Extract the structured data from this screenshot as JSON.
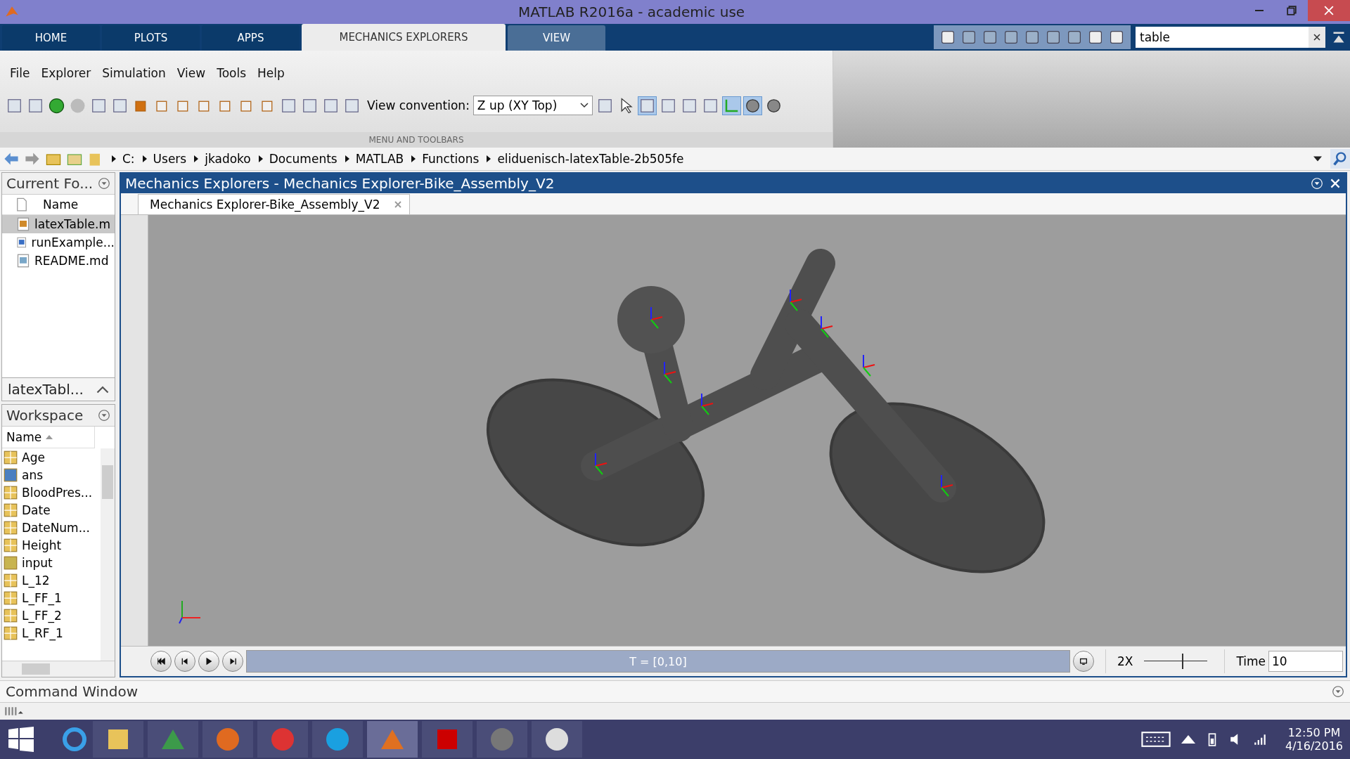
{
  "window": {
    "title": "MATLAB R2016a - academic use"
  },
  "ribbon_tabs": [
    {
      "label": "HOME",
      "selected": false
    },
    {
      "label": "PLOTS",
      "selected": false
    },
    {
      "label": "APPS",
      "selected": false
    },
    {
      "label": "MECHANICS EXPLORERS",
      "selected": true
    },
    {
      "label": "VIEW",
      "selected": false
    }
  ],
  "search": {
    "value": "table"
  },
  "menu": [
    "File",
    "Explorer",
    "Simulation",
    "View",
    "Tools",
    "Help"
  ],
  "view_convention": {
    "label": "View convention:",
    "value": "Z up (XY Top)"
  },
  "toolstrip_section": "MENU AND TOOLBARS",
  "path": [
    "C:",
    "Users",
    "jkadoko",
    "Documents",
    "MATLAB",
    "Functions",
    "eliduenisch-latexTable-2b505fe"
  ],
  "current_folder": {
    "title": "Current Fo...",
    "column": "Name",
    "details": "latexTabl...",
    "files": [
      {
        "name": "latexTable.m",
        "selected": true,
        "kind": "function"
      },
      {
        "name": "runExample...",
        "selected": false,
        "kind": "script"
      },
      {
        "name": "README.md",
        "selected": false,
        "kind": "doc"
      }
    ]
  },
  "workspace": {
    "title": "Workspace",
    "column": "Name",
    "variables": [
      {
        "name": "Age",
        "kind": "table"
      },
      {
        "name": "ans",
        "kind": "object"
      },
      {
        "name": "BloodPres...",
        "kind": "table"
      },
      {
        "name": "Date",
        "kind": "table"
      },
      {
        "name": "DateNum...",
        "kind": "table"
      },
      {
        "name": "Height",
        "kind": "table"
      },
      {
        "name": "input",
        "kind": "enum"
      },
      {
        "name": "L_12",
        "kind": "table"
      },
      {
        "name": "L_FF_1",
        "kind": "table"
      },
      {
        "name": "L_FF_2",
        "kind": "table"
      },
      {
        "name": "L_RF_1",
        "kind": "table"
      }
    ]
  },
  "explorer": {
    "title": "Mechanics Explorers - Mechanics Explorer-Bike_Assembly_V2",
    "tab": "Mechanics Explorer-Bike_Assembly_V2",
    "playback": {
      "label": "T = [0,10]",
      "level": 1
    },
    "speed": {
      "label": "2X",
      "level": 0.6
    },
    "time": {
      "label": "Time",
      "value": "10"
    }
  },
  "command_window": {
    "title": "Command Window"
  },
  "clock": {
    "time": "12:50 PM",
    "date": "4/16/2016"
  }
}
